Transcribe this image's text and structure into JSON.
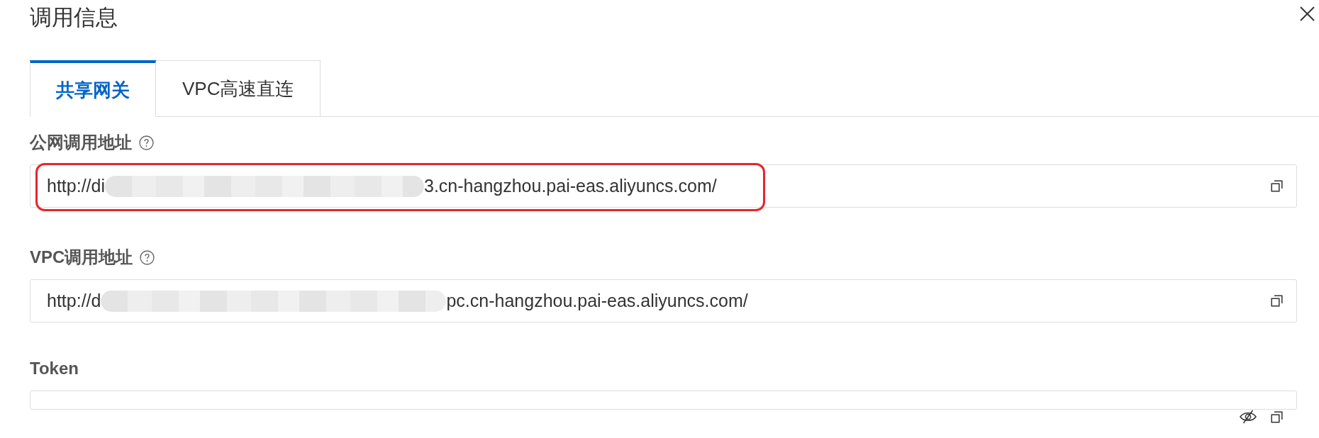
{
  "dialog": {
    "title": "调用信息"
  },
  "tabs": [
    {
      "label": "共享网关",
      "selected": true
    },
    {
      "label": "VPC高速直连",
      "selected": false
    }
  ],
  "fields": [
    {
      "kind": "url",
      "label": "公网调用地址",
      "value_start": "http://di",
      "redacted": true,
      "value_end": "3.cn-hangzhou.pai-eas.aliyuncs.com/",
      "highlighted": true
    },
    {
      "kind": "url",
      "label": "VPC调用地址",
      "value_start": "http://d",
      "redacted": true,
      "value_end": "pc.cn-hangzhou.pai-eas.aliyuncs.com/",
      "highlighted": false
    },
    {
      "kind": "secret",
      "label": "Token",
      "masked": true,
      "highlighted": false
    }
  ]
}
